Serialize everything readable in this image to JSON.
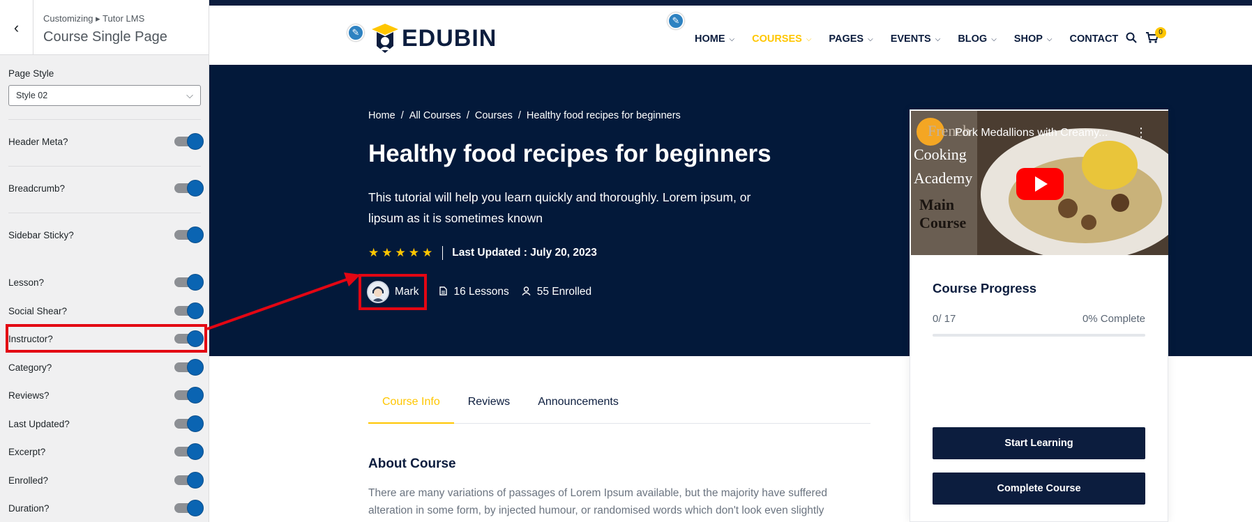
{
  "customizer": {
    "back_icon": "chevron-left-icon",
    "breadcrumb": "Customizing ▸ Tutor LMS",
    "title": "Course Single Page",
    "page_style_label": "Page Style",
    "page_style_value": "Style 02",
    "toggles": [
      {
        "label": "Header Meta?",
        "on": true
      },
      {
        "label": "Breadcrumb?",
        "on": true
      },
      {
        "label": "Sidebar Sticky?",
        "on": true
      },
      {
        "label": "Lesson?",
        "on": true
      },
      {
        "label": "Social Shear?",
        "on": true
      },
      {
        "label": "Instructor?",
        "on": true
      },
      {
        "label": "Category?",
        "on": true
      },
      {
        "label": "Reviews?",
        "on": true
      },
      {
        "label": "Last Updated?",
        "on": true
      },
      {
        "label": "Excerpt?",
        "on": true
      },
      {
        "label": "Enrolled?",
        "on": true
      },
      {
        "label": "Duration?",
        "on": true
      }
    ]
  },
  "site": {
    "logo_text": "EDUBIN",
    "menu": [
      {
        "label": "HOME",
        "has_caret": true,
        "active": false
      },
      {
        "label": "COURSES",
        "has_caret": true,
        "active": true
      },
      {
        "label": "PAGES",
        "has_caret": true,
        "active": false
      },
      {
        "label": "EVENTS",
        "has_caret": true,
        "active": false
      },
      {
        "label": "BLOG",
        "has_caret": true,
        "active": false
      },
      {
        "label": "SHOP",
        "has_caret": true,
        "active": false
      },
      {
        "label": "CONTACT",
        "has_caret": false,
        "active": false
      }
    ],
    "cart_count": "0",
    "colors": {
      "navy": "#03193a",
      "accent": "#ffc600",
      "annotation": "#e30613"
    }
  },
  "hero": {
    "breadcrumb": [
      "Home",
      "All Courses",
      "Courses",
      "Healthy food recipes for beginners"
    ],
    "breadcrumb_sep": "/",
    "title": "Healthy food recipes for beginners",
    "excerpt": "This tutorial will help you learn quickly and thoroughly. Lorem ipsum, or lipsum as it is sometimes known",
    "stars": 5,
    "last_updated": "Last Updated : July 20, 2023",
    "instructor": "Mark",
    "lessons": "16 Lessons",
    "enrolled": "55 Enrolled"
  },
  "card": {
    "video_title": "Pork Medallions with Creamy...",
    "video_overlay_text": [
      "French",
      "Cooking",
      "Academy",
      "Main",
      "Course"
    ],
    "progress_title": "Course Progress",
    "progress_count": "0/ 17",
    "progress_percent": "0% Complete",
    "progress_fraction": 0,
    "start_button": "Start Learning",
    "complete_button": "Complete Course"
  },
  "tabs": [
    {
      "label": "Course Info",
      "active": true
    },
    {
      "label": "Reviews",
      "active": false
    },
    {
      "label": "Announcements",
      "active": false
    }
  ],
  "about": {
    "title": "About Course",
    "text": "There are many variations of passages of Lorem Ipsum available, but the majority have suffered alteration in some form, by injected humour, or randomised words which don't look even slightly"
  }
}
